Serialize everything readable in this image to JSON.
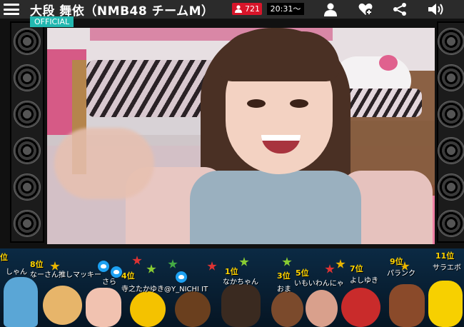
{
  "header": {
    "title": "大段 舞依（NMB48 チームM）",
    "official_label": "OFFICIAL",
    "viewer_count": "721",
    "time": "20:31〜",
    "icons": [
      "menu-icon",
      "person-icon",
      "heart-plus-icon",
      "share-icon",
      "speaker-icon"
    ]
  },
  "ranking": [
    {
      "rank": "位",
      "name": "しゃん"
    },
    {
      "rank": "8位",
      "name": "なーさん推しマッキー"
    },
    {
      "rank": "",
      "name": "さら"
    },
    {
      "rank": "4位",
      "name": "寺之たかゆき@Y_NICHI IT"
    },
    {
      "rank": "1位",
      "name": "なかちゃん"
    },
    {
      "rank": "3位",
      "name": "おま"
    },
    {
      "rank": "5位",
      "name": "いもいわんにゃ"
    },
    {
      "rank": "7位",
      "name": "よしゆき"
    },
    {
      "rank": "9位",
      "name": "パランク"
    },
    {
      "rank": "11位",
      "name": "サラエボ"
    }
  ],
  "colors": {
    "header_bg": "#2b2b2b",
    "official_bg": "#22b8b0",
    "viewer_bg": "#d8152a",
    "rank_text": "#ffd400"
  }
}
